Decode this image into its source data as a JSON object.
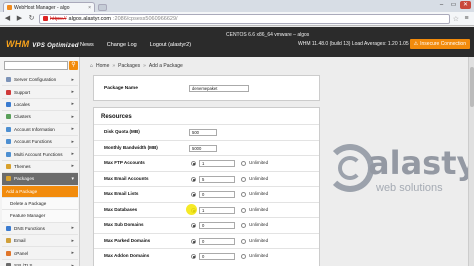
{
  "browser": {
    "tab_title": "WebHost Manager - algo",
    "tab_close": "×",
    "url_scheme": "https://",
    "url_host": "algos.alastyr.com",
    "url_path": ":2086/cpsess5060966629/",
    "window_controls": [
      "–",
      "▭",
      "✕"
    ]
  },
  "whm": {
    "logo": "WHM",
    "logo_sub": "VPS Optimized",
    "nav": [
      "News",
      "Change Log",
      "Logout (alastyr2)"
    ],
    "host_line": "CENTOS 6.6 x86_64 vmware – algos",
    "server_line": "WHM 11.48.0 (build 13)     Load Averages: 1.20 1.05 1.05",
    "insecure_label": "Insecure Connection"
  },
  "sidebar": {
    "items": [
      {
        "label": "Server Configuration",
        "color": "#7c93b8",
        "kind": "normal"
      },
      {
        "label": "Support",
        "color": "#d03a3a",
        "kind": "normal"
      },
      {
        "label": "Locales",
        "color": "#3a7bd0",
        "kind": "normal"
      },
      {
        "label": "Clusters",
        "color": "#5aa05a",
        "kind": "normal"
      },
      {
        "label": "Account Information",
        "color": "#4d8fd1",
        "kind": "normal"
      },
      {
        "label": "Account Functions",
        "color": "#4d8fd1",
        "kind": "normal"
      },
      {
        "label": "Multi Account Functions",
        "color": "#4d8fd1",
        "kind": "normal"
      },
      {
        "label": "Themes",
        "color": "#d8a12c",
        "kind": "normal"
      },
      {
        "label": "Packages",
        "color": "#d8a12c",
        "kind": "hdr"
      },
      {
        "label": "Add a Package",
        "color": "",
        "kind": "active"
      },
      {
        "label": "Delete a Package",
        "color": "",
        "kind": "sub"
      },
      {
        "label": "Feature Manager",
        "color": "",
        "kind": "sub"
      },
      {
        "label": "DNS Functions",
        "color": "#3a7bd0",
        "kind": "normal"
      },
      {
        "label": "Email",
        "color": "#d0a03a",
        "kind": "normal"
      },
      {
        "label": "cPanel",
        "color": "#e0752a",
        "kind": "normal"
      },
      {
        "label": "SSL/TLS",
        "color": "#6a6a6a",
        "kind": "normal"
      }
    ]
  },
  "breadcrumb": {
    "home": "Home",
    "section": "Packages",
    "page": "Add a Package"
  },
  "package_name": {
    "label": "Package Name",
    "value": "denemepaket"
  },
  "resources": {
    "title": "Resources",
    "rows": [
      {
        "label": "Disk Quota (MB)",
        "value": "500",
        "unlimited": null,
        "selected": "value"
      },
      {
        "label": "Monthly Bandwidth (MB)",
        "value": "5000",
        "unlimited": null,
        "selected": "value"
      },
      {
        "label": "Max FTP Accounts",
        "value": "1",
        "unlimited": "Unlimited",
        "selected": "value"
      },
      {
        "label": "Max Email Accounts",
        "value": "5",
        "unlimited": "Unlimited",
        "selected": "value"
      },
      {
        "label": "Max Email Lists",
        "value": "0",
        "unlimited": "Unlimited",
        "selected": "value"
      },
      {
        "label": "Max Databases",
        "value": "1",
        "unlimited": "Unlimited",
        "selected": "value"
      },
      {
        "label": "Max Sub Domains",
        "value": "0",
        "unlimited": "Unlimited",
        "selected": "value"
      },
      {
        "label": "Max Parked Domains",
        "value": "0",
        "unlimited": "Unlimited",
        "selected": "value"
      },
      {
        "label": "Max Addon Domains",
        "value": "0",
        "unlimited": "Unlimited",
        "selected": "value"
      }
    ]
  },
  "watermark": {
    "text": "alastyr",
    "tagline": "web solutions"
  }
}
